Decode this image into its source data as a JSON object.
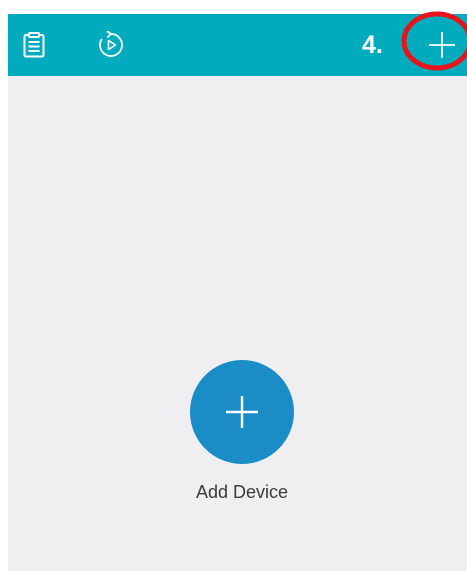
{
  "header": {
    "step_label": "4.",
    "icons": {
      "list": "clipboard-list-icon",
      "playback": "replay-icon",
      "add": "plus-icon"
    }
  },
  "main": {
    "add_device_label": "Add Device"
  },
  "colors": {
    "header_bg": "#00abbe",
    "content_bg": "#efeff2",
    "fab_bg": "#1a8dc6",
    "annotation": "#e8141c"
  }
}
